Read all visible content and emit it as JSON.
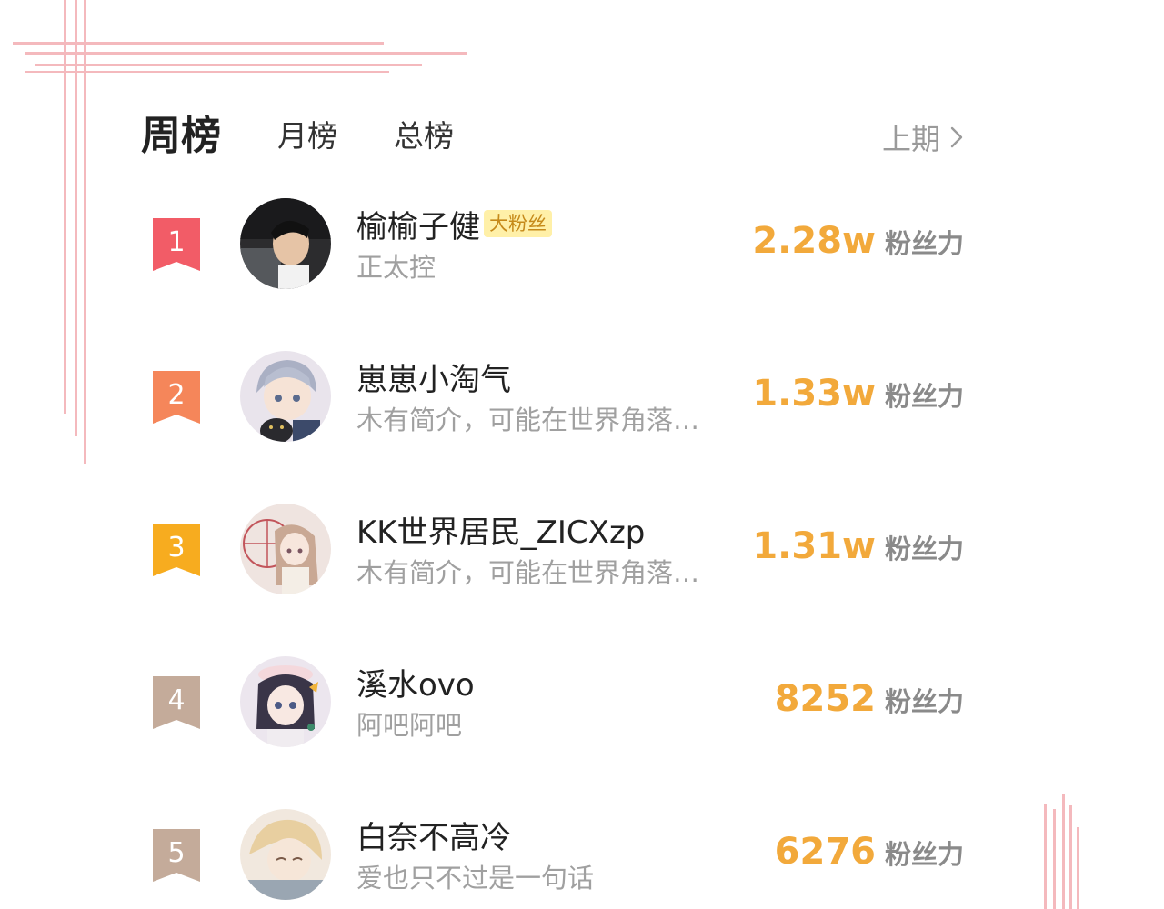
{
  "header": {
    "tabs": [
      {
        "label": "周榜",
        "active": true
      },
      {
        "label": "月榜",
        "active": false
      },
      {
        "label": "总榜",
        "active": false
      }
    ],
    "prev_label": "上期"
  },
  "colors": {
    "score": "#f2a93b",
    "rank_1": "#f25c67",
    "rank_2": "#f5865a",
    "rank_3": "#f7ac1f",
    "rank_other": "#c4ab9a",
    "fan_tag_bg": "#fff0a8",
    "decor_lines": "#f4b9bd"
  },
  "ranking": [
    {
      "rank": "1",
      "name": "榆榆子健",
      "tag": "大粉丝",
      "bio": "正太控",
      "score": "2.28w",
      "unit": "粉丝力",
      "avatar": "avatar-boy-photo"
    },
    {
      "rank": "2",
      "name": "崽崽小淘气",
      "tag": "",
      "bio": "木有简介，可能在世界角落…",
      "score": "1.33w",
      "unit": "粉丝力",
      "avatar": "avatar-anime-boy-cat"
    },
    {
      "rank": "3",
      "name": "KK世界居民_ZICXzp",
      "tag": "",
      "bio": "木有简介，可能在世界角落…",
      "score": "1.31w",
      "unit": "粉丝力",
      "avatar": "avatar-anime-girl-window"
    },
    {
      "rank": "4",
      "name": "溪水ovo",
      "tag": "",
      "bio": "阿吧阿吧",
      "score": "8252",
      "unit": "粉丝力",
      "avatar": "avatar-anime-girl-hat"
    },
    {
      "rank": "5",
      "name": "白奈不高冷",
      "tag": "",
      "bio": "爱也只不过是一句话",
      "score": "6276",
      "unit": "粉丝力",
      "avatar": "avatar-anime-blonde"
    }
  ]
}
